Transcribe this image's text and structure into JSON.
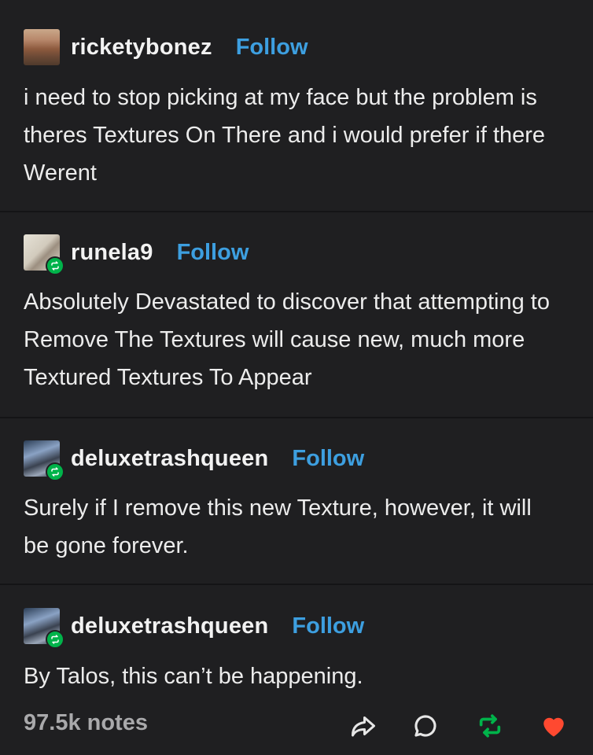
{
  "colors": {
    "background": "#1f1f21",
    "text": "#ececec",
    "follow": "#3d9fe0",
    "reblog": "#00b34a",
    "heart": "#ff4930",
    "notes": "#a9a9ab"
  },
  "posts": [
    {
      "username": "ricketybonez",
      "follow_label": "Follow",
      "text": "i need to stop picking at my face but the problem is theres Textures On There and i would prefer if there Werent"
    },
    {
      "username": "runela9",
      "follow_label": "Follow",
      "text": "Absolutely Devastated to discover that attempting to Remove The Textures will cause new, much more Textured Textures To Appear"
    },
    {
      "username": "deluxetrashqueen",
      "follow_label": "Follow",
      "text": "Surely if I remove this new Texture, however, it will be gone forever."
    },
    {
      "username": "deluxetrashqueen",
      "follow_label": "Follow",
      "text": "By Talos, this can’t be happening."
    }
  ],
  "footer": {
    "notes": "97.5k notes",
    "icons": [
      "share-icon",
      "reply-icon",
      "reblog-icon",
      "like-icon"
    ]
  }
}
